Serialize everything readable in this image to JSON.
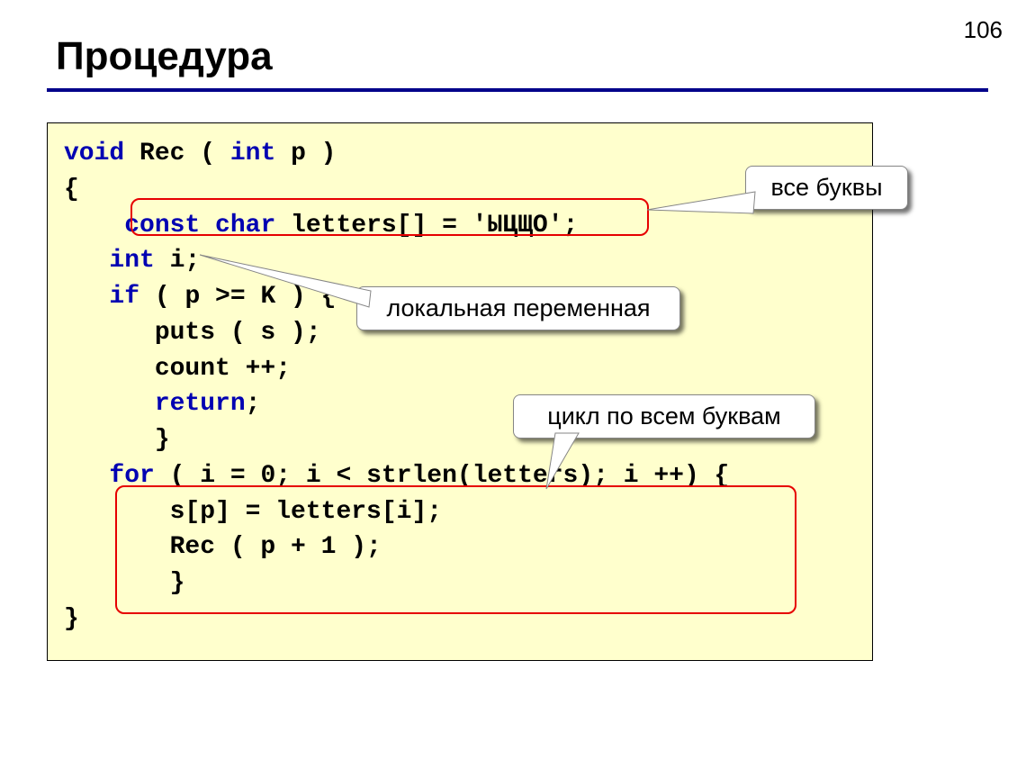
{
  "page_number": "106",
  "title": "Процедура",
  "code": {
    "l1_a": "void",
    "l1_b": " Rec ( ",
    "l1_c": "int",
    "l1_d": " p )",
    "l2": "{",
    "l3_a": "    ",
    "l3_b": "const char",
    "l3_c": " letters[] = 'ЫЦЩО';",
    "l4_a": "   ",
    "l4_b": "int",
    "l4_c": " i;",
    "l5_a": "   ",
    "l5_b": "if",
    "l5_c": " ( p >= K ) {",
    "l6": "      puts ( s );",
    "l7": "      count ++;",
    "l8_a": "      ",
    "l8_b": "return",
    "l8_c": ";",
    "l9": "      }",
    "l10_a": "   ",
    "l10_b": "for",
    "l10_c": " ( i = 0; i < strlen(letters); i ++) {",
    "l11": "       s[p] = letters[i];",
    "l12": "       Rec ( p + 1 );",
    "l13": "       }",
    "l14": "}"
  },
  "callouts": {
    "c1": "все буквы",
    "c2": "локальная переменная",
    "c3": "цикл по всем буквам"
  }
}
